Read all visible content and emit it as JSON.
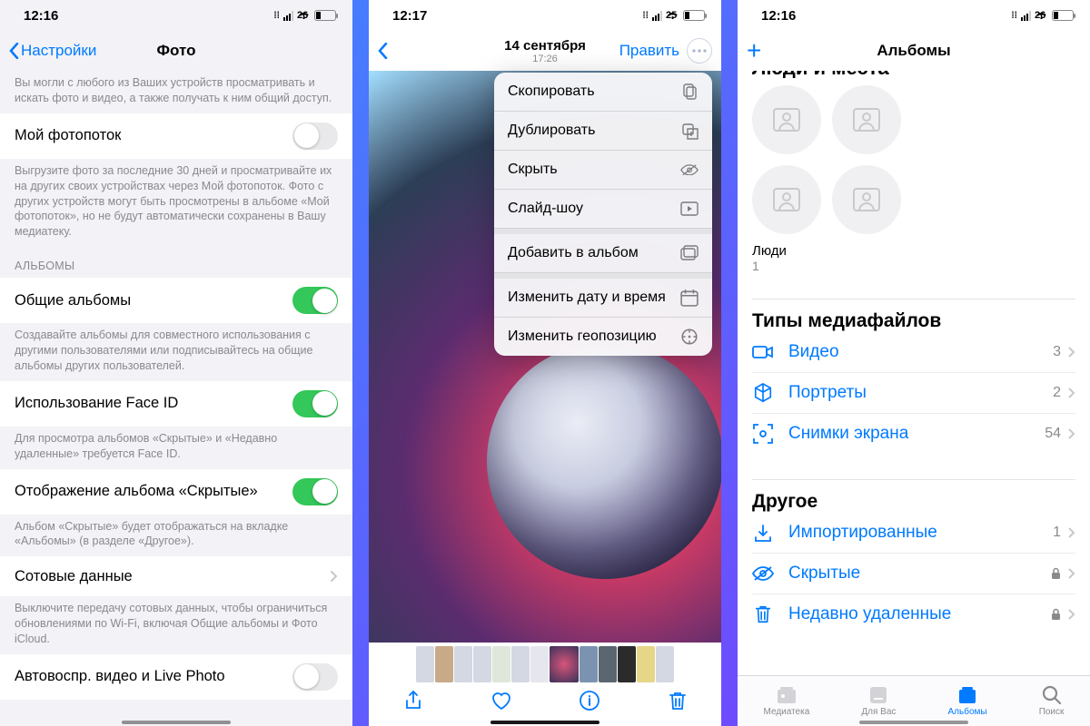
{
  "phone1": {
    "time": "12:16",
    "battery": "26",
    "back_label": "Настройки",
    "title": "Фото",
    "intro_footer": "Вы могли с любого из Ваших устройств просматривать и искать фото и видео, а также получать к ним общий доступ.",
    "photostream_label": "Мой фотопоток",
    "photostream_on": false,
    "photostream_footer": "Выгрузите фото за последние 30 дней и просматривайте их на других своих устройствах через Мой фотопоток. Фото с других устройств могут быть просмотрены в альбоме «Мой фотопоток», но не будут автоматически сохранены в Вашу медиатеку.",
    "albums_section": "АЛЬБОМЫ",
    "shared_albums_label": "Общие альбомы",
    "shared_albums_on": true,
    "shared_albums_footer": "Создавайте альбомы для совместного использования с другими пользователями или подписывайтесь на общие альбомы других пользователей.",
    "faceid_label": "Использование Face ID",
    "faceid_on": true,
    "faceid_footer": "Для просмотра альбомов «Скрытые» и «Недавно удаленные» требуется Face ID.",
    "hidden_label": "Отображение альбома «Скрытые»",
    "hidden_on": true,
    "hidden_footer": "Альбом «Скрытые» будет отображаться на вкладке «Альбомы» (в разделе «Другое»).",
    "cellular_label": "Сотовые данные",
    "cellular_footer": "Выключите передачу сотовых данных, чтобы ограничиться обновлениями по Wi-Fi, включая Общие альбомы и Фото iCloud.",
    "autoplay_label": "Автовоспр. видео и Live Photo"
  },
  "phone2": {
    "time": "12:17",
    "battery": "25",
    "date": "14 сентября",
    "subdate": "17:26",
    "edit_label": "Править",
    "menu": {
      "copy": "Скопировать",
      "duplicate": "Дублировать",
      "hide": "Скрыть",
      "slideshow": "Слайд-шоу",
      "add_album": "Добавить в альбом",
      "adjust_date": "Изменить дату и время",
      "adjust_location": "Изменить геопозицию"
    }
  },
  "phone3": {
    "time": "12:16",
    "battery": "26",
    "title": "Альбомы",
    "people_places_cut": "Люди и места",
    "people_label": "Люди",
    "people_count": "1",
    "mediatypes_title": "Типы медиафайлов",
    "rows": {
      "video": {
        "label": "Видео",
        "count": "3"
      },
      "portraits": {
        "label": "Портреты",
        "count": "2"
      },
      "screenshots": {
        "label": "Снимки экрана",
        "count": "54"
      }
    },
    "other_title": "Другое",
    "other": {
      "imported": {
        "label": "Импортированные",
        "count": "1"
      },
      "hidden": {
        "label": "Скрытые"
      },
      "deleted": {
        "label": "Недавно удаленные"
      }
    },
    "tabs": {
      "library": "Медиатека",
      "foryou": "Для Вас",
      "albums": "Альбомы",
      "search": "Поиск"
    }
  }
}
